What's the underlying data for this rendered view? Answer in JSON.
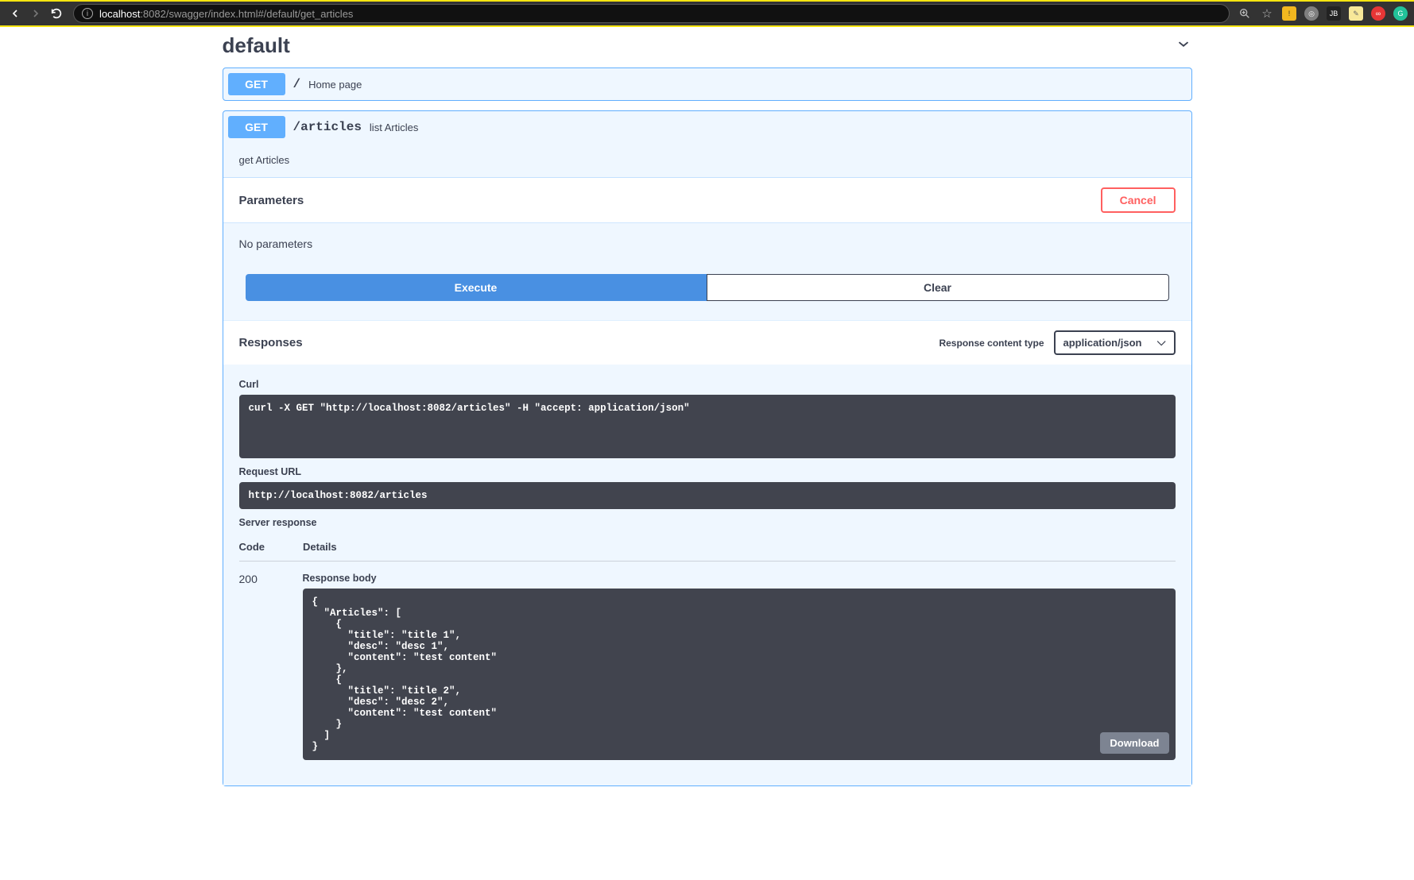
{
  "browser": {
    "url_host": "localhost",
    "url_port_path": ":8082/swagger/index.html#/default/get_articles"
  },
  "section": {
    "title": "default"
  },
  "operations": [
    {
      "method": "GET",
      "path": "/",
      "summary": "Home page",
      "expanded": false
    },
    {
      "method": "GET",
      "path": "/articles",
      "summary": "list Articles",
      "expanded": true,
      "description": "get Articles",
      "parameters": {
        "title": "Parameters",
        "cancel_label": "Cancel",
        "empty_text": "No parameters",
        "execute_label": "Execute",
        "clear_label": "Clear"
      },
      "responses": {
        "title": "Responses",
        "content_type_label": "Response content type",
        "content_type_value": "application/json",
        "curl_label": "Curl",
        "curl_text": "curl -X GET \"http://localhost:8082/articles\" -H \"accept: application/json\"",
        "request_url_label": "Request URL",
        "request_url_text": "http://localhost:8082/articles",
        "server_response_label": "Server response",
        "code_header": "Code",
        "details_header": "Details",
        "code": "200",
        "response_body_label": "Response body",
        "response_body_text": "{\n  \"Articles\": [\n    {\n      \"title\": \"title 1\",\n      \"desc\": \"desc 1\",\n      \"content\": \"test content\"\n    },\n    {\n      \"title\": \"title 2\",\n      \"desc\": \"desc 2\",\n      \"content\": \"test content\"\n    }\n  ]\n}",
        "download_label": "Download"
      }
    }
  ]
}
